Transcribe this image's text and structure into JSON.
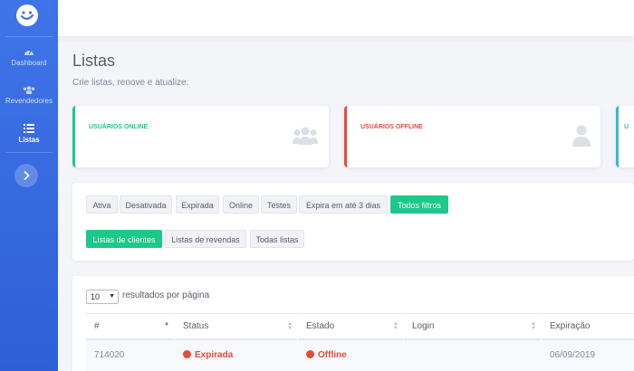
{
  "sidebar": {
    "items": [
      {
        "label": "Dashboard",
        "icon": "dashboard-gauge-icon"
      },
      {
        "label": "Revendedores",
        "icon": "users-icon"
      },
      {
        "label": "Listas",
        "icon": "list-icon",
        "active": true
      }
    ],
    "toggle_icon": "chevron-right-icon",
    "logo_icon": "smiley-logo-icon"
  },
  "header": {
    "title": "Listas",
    "subtitle": "Crie listas, renove e atualize."
  },
  "cards": [
    {
      "title": "USUÁRIOS ONLINE",
      "color": "#1cc88a",
      "icon": "users-icon"
    },
    {
      "title": "USUÁRIOS OFFLINE",
      "color": "#e74a3b",
      "icon": "user-icon"
    },
    {
      "title": "U",
      "color": "#36b9cc",
      "icon": ""
    }
  ],
  "filters": {
    "row1": [
      "Ativa",
      "Desativada",
      "Expirada",
      "Online",
      "Testes",
      "Expira em até 3 dias",
      "Todos filtros"
    ],
    "row1_selected": "Todos filtros",
    "row2": [
      "Listas de clientes",
      "Listas de revendas",
      "Todas listas"
    ],
    "row2_selected": "Listas de clientes"
  },
  "table": {
    "page_size": "10",
    "page_size_suffix": "resultados por página",
    "columns": [
      "#",
      "Status",
      "Estado",
      "Login",
      "Expiração"
    ],
    "rows": [
      {
        "id": "714020",
        "status": "Expirada",
        "estado": "Offline",
        "login": "",
        "expiracao": "06/09/2019"
      }
    ]
  },
  "colors": {
    "sidebar": "#3f74e8",
    "success": "#1cc88a",
    "danger": "#e74a3b",
    "info": "#36b9cc"
  }
}
